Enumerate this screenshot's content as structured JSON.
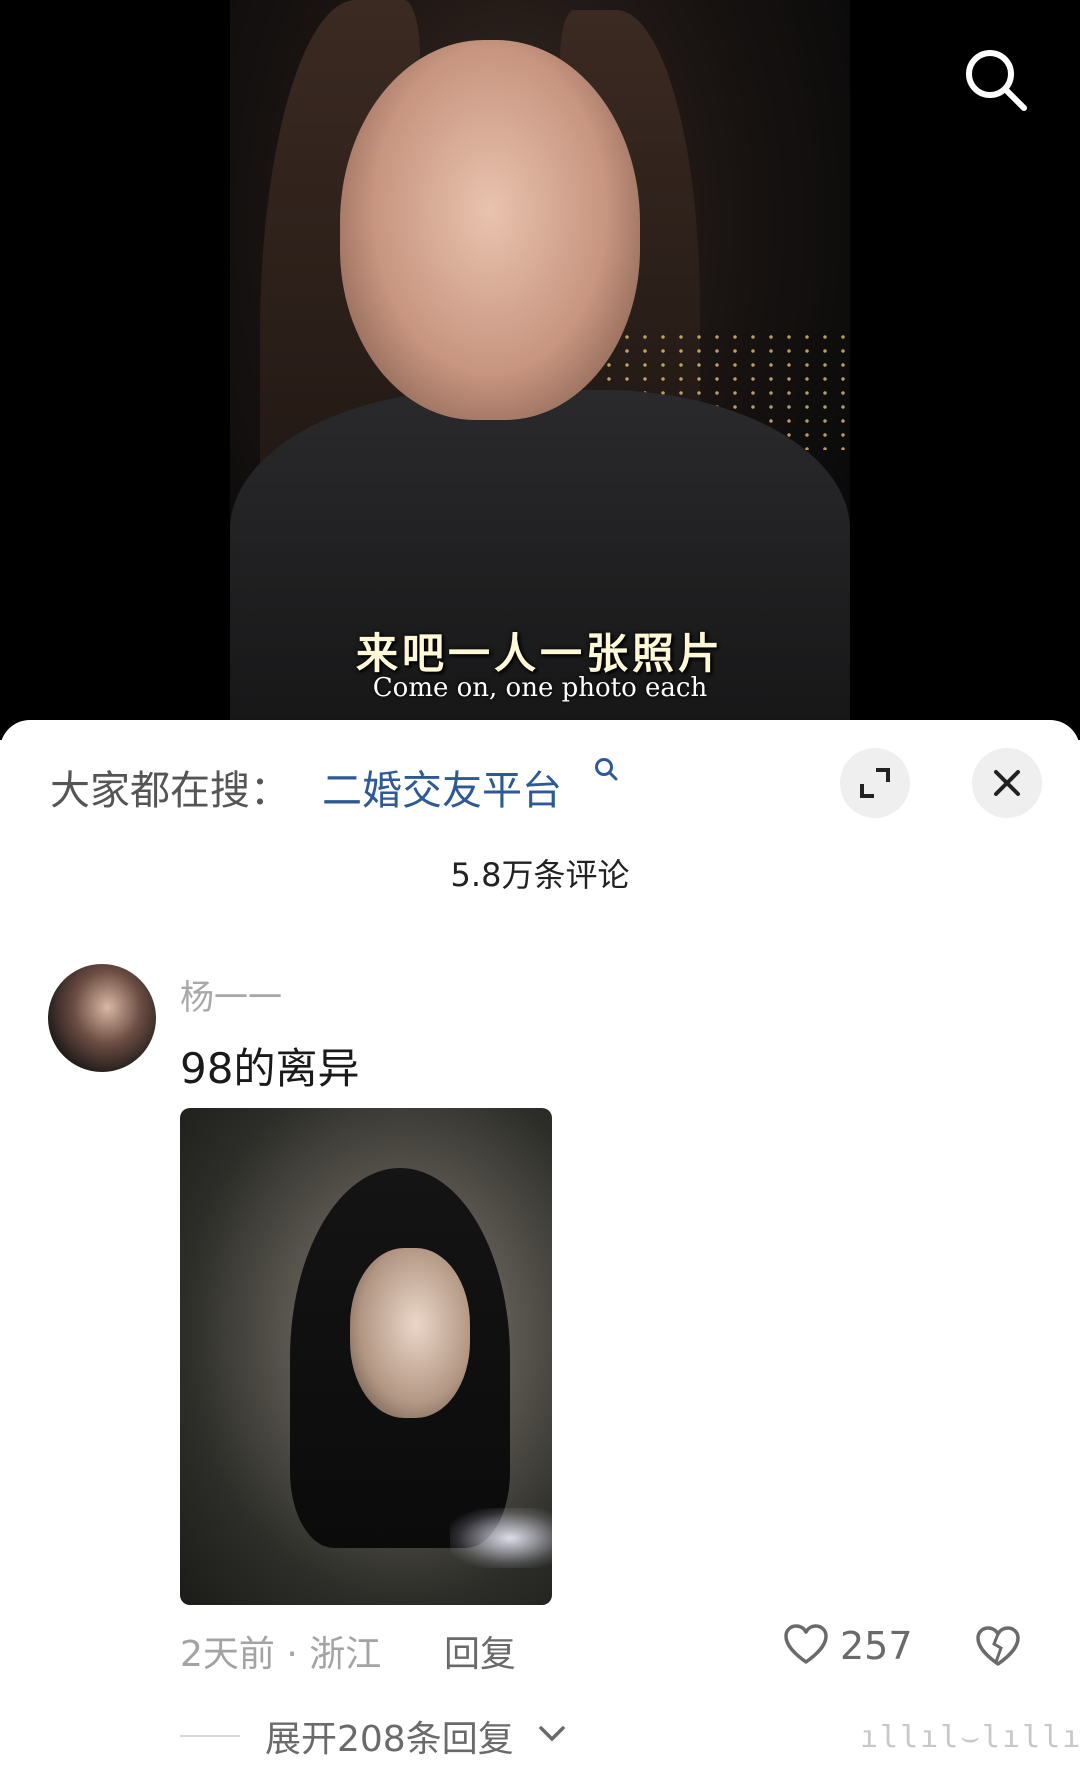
{
  "video": {
    "subtitle_zh": "来吧一人一张照片",
    "subtitle_en": "Come on, one photo each",
    "search_icon": "search-icon"
  },
  "sheet": {
    "search_prefix": "大家都在搜：",
    "search_term": "二婚交友平台",
    "comment_count": "5.8万条评论",
    "expand_icon": "expand-icon",
    "close_icon": "close-icon"
  },
  "comment": {
    "username": "杨一一",
    "text": "98的离异",
    "time_location": "2天前 · 浙江",
    "reply_label": "回复",
    "like_count": "257",
    "expand_replies": "展开208条回复"
  },
  "watermark": "ıllıl⌣lıllı"
}
